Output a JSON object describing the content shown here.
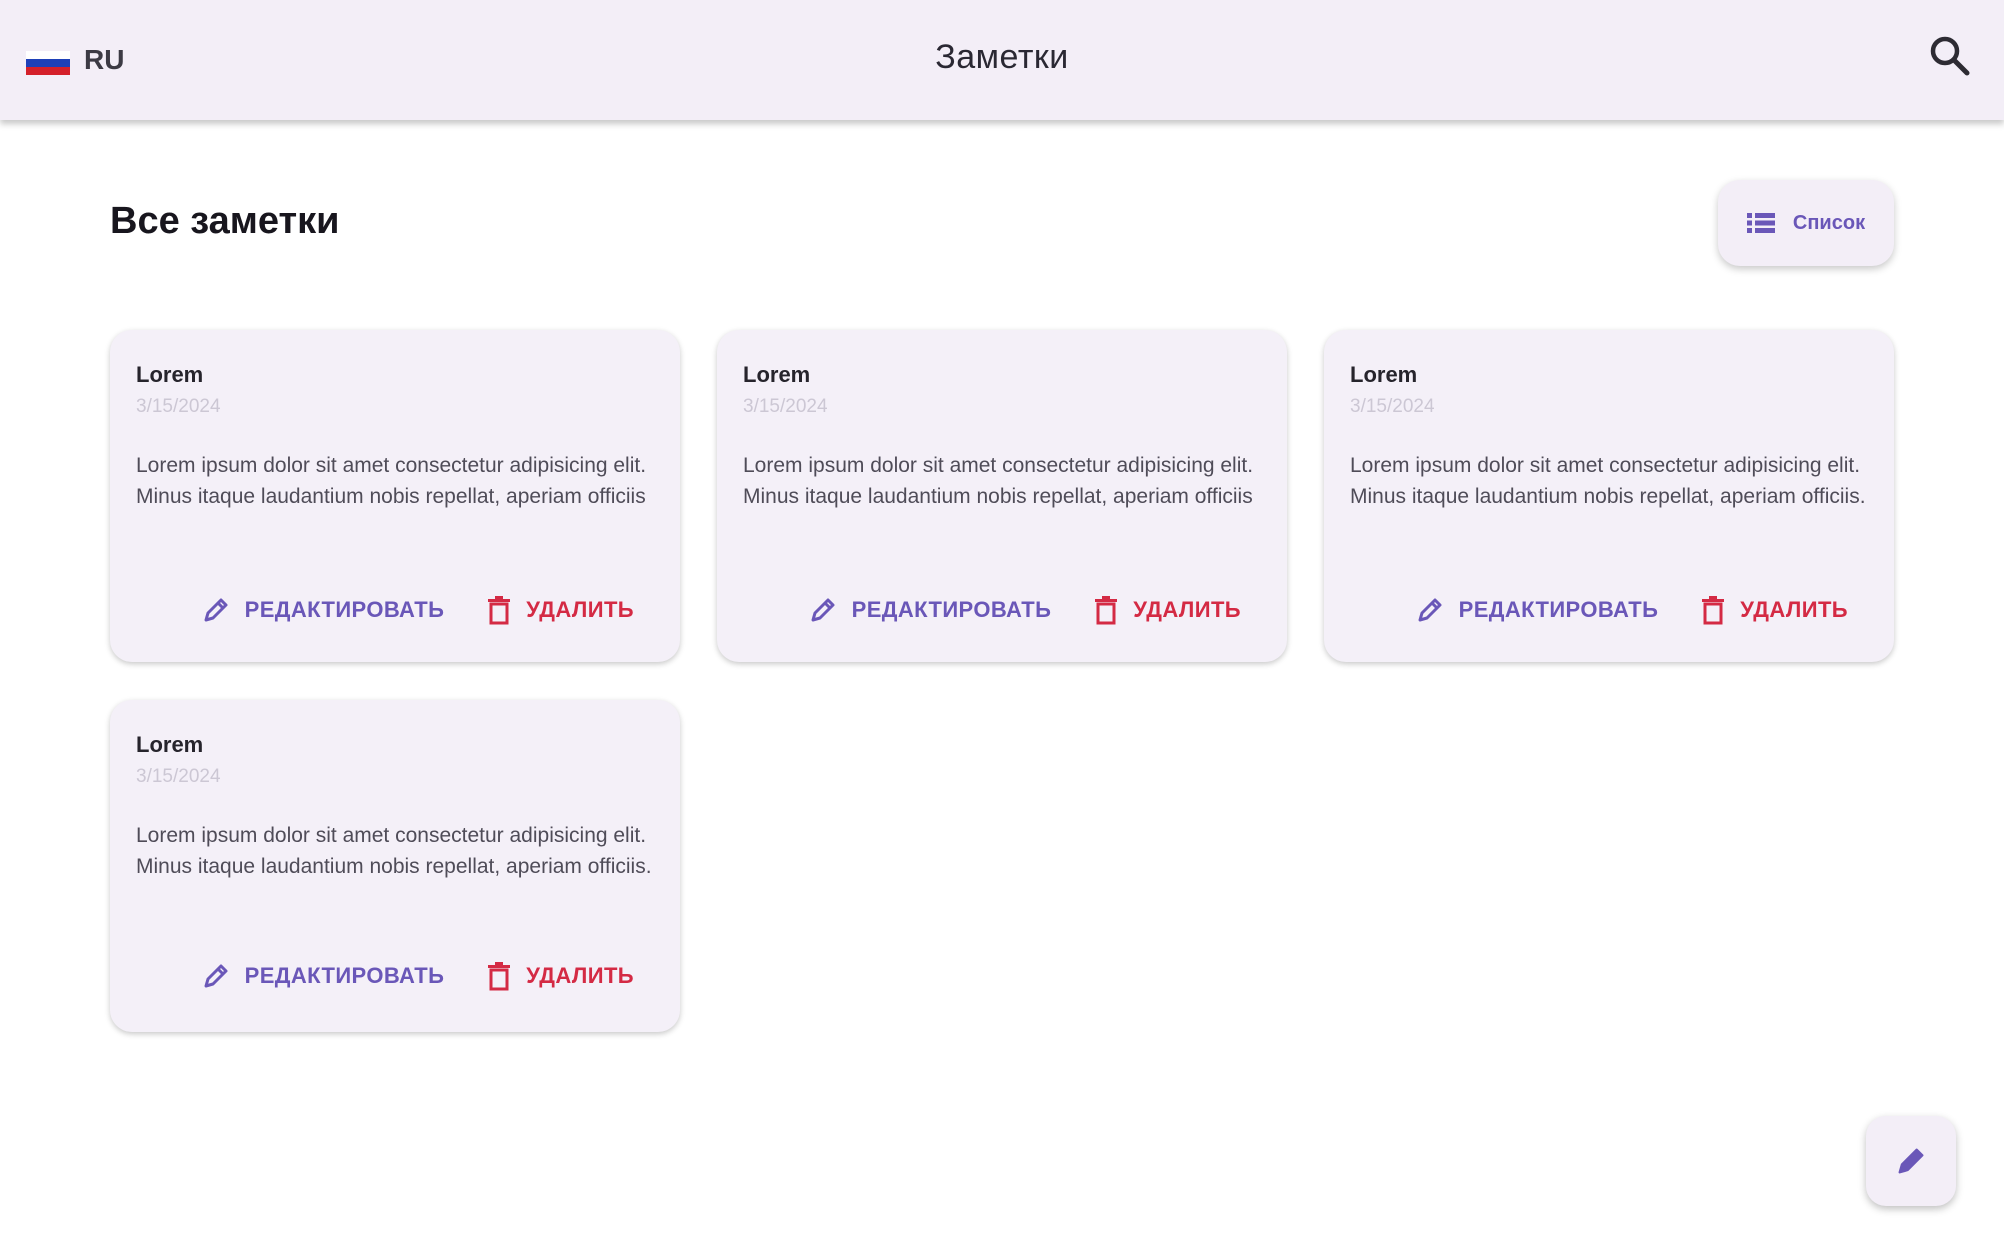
{
  "appbar": {
    "language": {
      "code": "RU",
      "flag_icon": "russia-flag-icon"
    },
    "title": "Заметки",
    "search_icon": "search-icon"
  },
  "main": {
    "heading": "Все заметки",
    "view_toggle": {
      "label": "Список",
      "icon": "list-icon"
    }
  },
  "notes": [
    {
      "title": "Lorem",
      "date": "3/15/2024",
      "text": "Lorem ipsum dolor sit amet consectetur adipisicing elit. Minus itaque laudantium nobis repellat, aperiam officiis",
      "edit_label": "РЕДАКТИРОВАТЬ",
      "delete_label": "УДАЛИТЬ"
    },
    {
      "title": "Lorem",
      "date": "3/15/2024",
      "text": "Lorem ipsum dolor sit amet consectetur adipisicing elit. Minus itaque laudantium nobis repellat, aperiam officiis",
      "edit_label": "РЕДАКТИРОВАТЬ",
      "delete_label": "УДАЛИТЬ"
    },
    {
      "title": "Lorem",
      "date": "3/15/2024",
      "text": "Lorem ipsum dolor sit amet consectetur adipisicing elit. Minus itaque laudantium nobis repellat, aperiam officiis.",
      "edit_label": "РЕДАКТИРОВАТЬ",
      "delete_label": "УДАЛИТЬ"
    },
    {
      "title": "Lorem",
      "date": "3/15/2024",
      "text": "Lorem ipsum dolor sit amet consectetur adipisicing elit. Minus itaque laudantium nobis repellat, aperiam officiis.",
      "edit_label": "РЕДАКТИРОВАТЬ",
      "delete_label": "УДАЛИТЬ"
    }
  ],
  "fab": {
    "icon": "pencil-icon"
  },
  "colors": {
    "primary": "#6a57b8",
    "danger": "#d42a44",
    "surface": "#f3eef7"
  }
}
